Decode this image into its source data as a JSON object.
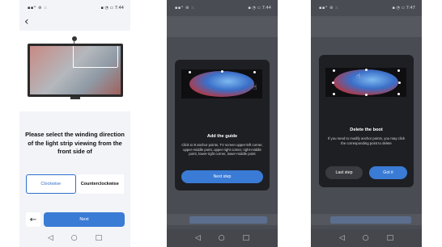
{
  "status_bar": {
    "left": "▪▪ᐞ ⊛ ⁙",
    "right": "▪ ◔ ▭ 7:44",
    "right_p3": "▪ ◔ ▭ 7:47"
  },
  "nav_bar": {
    "back": "◁",
    "home": "○",
    "recent": "□"
  },
  "screen1": {
    "back_icon": "‹",
    "heading": "Please select the winding direction of the light strip viewing from the front side of",
    "options": [
      {
        "label": "Clockwise",
        "selected": true
      },
      {
        "label": "Counterclockwise",
        "selected": false
      }
    ],
    "arrow_icon": "←",
    "next_label": "Next"
  },
  "screen2": {
    "title": "Add the guide",
    "body": "Click to 8 anchor points, TV screen upper-left corner, upper-middle point, upper-right corner, right-middle point, lower-right corner, lower-middle point",
    "button": "Next step",
    "hand_icon": "hand-pointer-icon"
  },
  "screen3": {
    "title": "Delete the boot",
    "body": "If you need to modify anchor points, you may click the corresponding point to delete",
    "secondary_button": "Last step",
    "primary_button": "Got it",
    "hand_icon": "hand-pointer-icon"
  },
  "colors": {
    "accent": "#3a7bd5",
    "dialog_bg": "#1e1f23",
    "overlay_bg": "#4a4c54"
  }
}
